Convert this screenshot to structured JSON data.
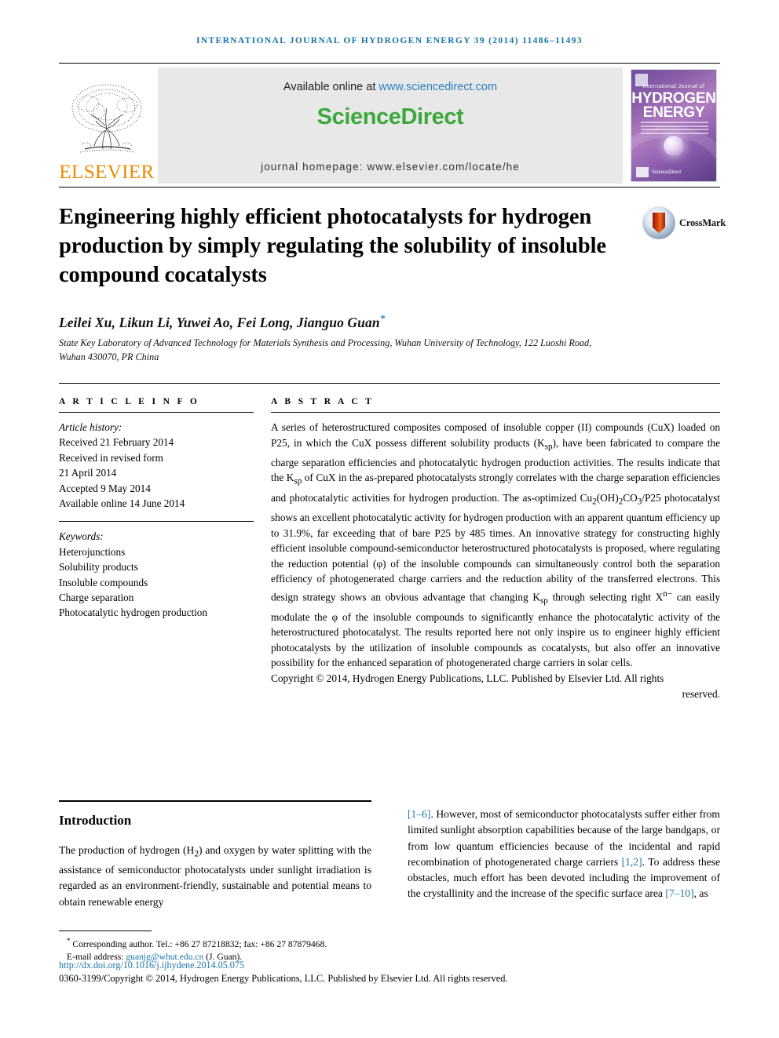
{
  "running_head": "International Journal of Hydrogen Energy 39 (2014) 11486–11493",
  "masthead": {
    "publisher": "ELSEVIER",
    "available_prefix": "Available online at ",
    "sciencedirect_url": "www.sciencedirect.com",
    "sciencedirect_logo": "ScienceDirect",
    "journal_homepage": "journal homepage: www.elsevier.com/locate/he",
    "cover": {
      "line1": "International Journal of",
      "line2": "HYDROGEN",
      "line3": "ENERGY",
      "footer_badge": "ScienceDirect"
    }
  },
  "crossmark": {
    "label": "CrossMark"
  },
  "title": "Engineering highly efficient photocatalysts for hydrogen production by simply regulating the solubility of insoluble compound cocatalysts",
  "authors": "Leilei Xu, Likun Li, Yuwei Ao, Fei Long, Jianguo Guan",
  "author_star": "*",
  "affiliation": "State Key Laboratory of Advanced Technology for Materials Synthesis and Processing, Wuhan University of Technology, 122 Luoshi Road, Wuhan 430070, PR China",
  "article_info": {
    "heading": "A R T I C L E   I N F O",
    "history_label": "Article history:",
    "history": [
      "Received 21 February 2014",
      "Received in revised form",
      "21 April 2014",
      "Accepted 9 May 2014",
      "Available online 14 June 2014"
    ],
    "keywords_label": "Keywords:",
    "keywords": [
      "Heterojunctions",
      "Solubility products",
      "Insoluble compounds",
      "Charge separation",
      "Photocatalytic hydrogen production"
    ]
  },
  "abstract": {
    "heading": "A B S T R A C T",
    "body": "A series of heterostructured composites composed of insoluble copper (II) compounds (CuX) loaded on P25, in which the CuX possess different solubility products (Ksp), have been fabricated to compare the charge separation efficiencies and photocatalytic hydrogen production activities. The results indicate that the Ksp of CuX in the as-prepared photocatalysts strongly correlates with the charge separation efficiencies and photocatalytic activities for hydrogen production. The as-optimized Cu2(OH)2CO3/P25 photocatalyst shows an excellent photocatalytic activity for hydrogen production with an apparent quantum efficiency up to 31.9%, far exceeding that of bare P25 by 485 times. An innovative strategy for constructing highly efficient insoluble compound-semiconductor heterostructured photocatalysts is proposed, where regulating the reduction potential (φ) of the insoluble compounds can simultaneously control both the separation efficiency of photogenerated charge carriers and the reduction ability of the transferred electrons. This design strategy shows an obvious advantage that changing Ksp through selecting right Xn− can easily modulate the φ of the insoluble compounds to significantly enhance the photocatalytic activity of the heterostructured photocatalyst. The results reported here not only inspire us to engineer highly efficient photocatalysts by the utilization of insoluble compounds as cocatalysts, but also offer an innovative possibility for the enhanced separation of photogenerated charge carriers in solar cells.",
    "copyright": "Copyright © 2014, Hydrogen Energy Publications, LLC. Published by Elsevier Ltd. All rights",
    "copyright_tail": "reserved."
  },
  "introduction": {
    "heading": "Introduction",
    "col1": "The production of hydrogen (H2) and oxygen by water splitting with the assistance of semiconductor photocatalysts under sunlight irradiation is regarded as an environment-friendly, sustainable and potential means to obtain renewable energy",
    "col2_ref1": "[1–6]",
    "col2_part1": ". However, most of semiconductor photocatalysts suffer either from limited sunlight absorption capabilities because of the large bandgaps, or from low quantum efficiencies because of the incidental and rapid recombination of photogenerated charge carriers ",
    "col2_ref2": "[1,2]",
    "col2_part2": ". To address these obstacles, much effort has been devoted including the improvement of the crystallinity and the increase of the specific surface area ",
    "col2_ref3": "[7–10]",
    "col2_part3": ", as"
  },
  "footer": {
    "corresponding": "Corresponding author. Tel.: +86 27 87218832; fax: +86 27 87879468.",
    "email_label": "E-mail address: ",
    "email": "guanjg@whut.edu.cn",
    "email_suffix": " (J. Guan).",
    "doi": "http://dx.doi.org/10.1016/j.ijhydene.2014.05.075",
    "issn_line": "0360-3199/Copyright © 2014, Hydrogen Energy Publications, LLC. Published by Elsevier Ltd. All rights reserved."
  },
  "colors": {
    "link": "#1a74a8",
    "sciencedirect_green": "#3CA83C",
    "elsevier_orange": "#ED8B00"
  }
}
